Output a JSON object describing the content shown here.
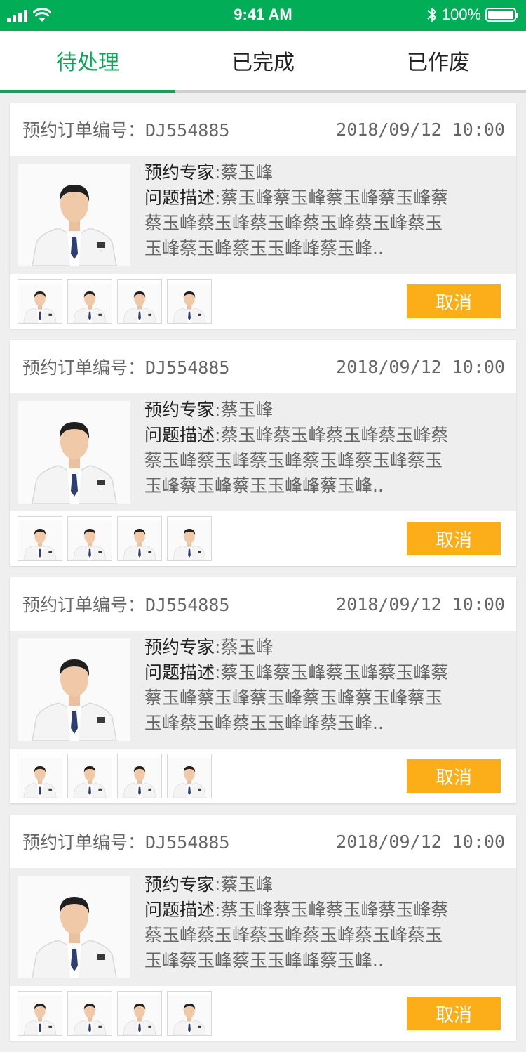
{
  "status_bar": {
    "time": "9:41 AM",
    "battery": "100%"
  },
  "tabs": [
    {
      "label": "待处理",
      "active": true
    },
    {
      "label": "已完成",
      "active": false
    },
    {
      "label": "已作废",
      "active": false
    }
  ],
  "orders": [
    {
      "order_label": "预约订单编号：DJ554885",
      "datetime": "2018/09/12 10:00",
      "expert_label": "预约专家",
      "expert_name": ":蔡玉峰",
      "desc_label": "问题描述",
      "desc_line1": ":蔡玉峰蔡玉峰蔡玉峰蔡玉峰蔡",
      "desc_line2": "蔡玉峰蔡玉峰蔡玉峰蔡玉峰蔡玉峰蔡玉",
      "desc_line3": "玉峰蔡玉峰蔡玉玉峰峰蔡玉峰..",
      "cancel_label": "取消"
    },
    {
      "order_label": "预约订单编号：DJ554885",
      "datetime": "2018/09/12 10:00",
      "expert_label": "预约专家",
      "expert_name": ":蔡玉峰",
      "desc_label": "问题描述",
      "desc_line1": ":蔡玉峰蔡玉峰蔡玉峰蔡玉峰蔡",
      "desc_line2": "蔡玉峰蔡玉峰蔡玉峰蔡玉峰蔡玉峰蔡玉",
      "desc_line3": "玉峰蔡玉峰蔡玉玉峰峰蔡玉峰..",
      "cancel_label": "取消"
    },
    {
      "order_label": "预约订单编号：DJ554885",
      "datetime": "2018/09/12 10:00",
      "expert_label": "预约专家",
      "expert_name": ":蔡玉峰",
      "desc_label": "问题描述",
      "desc_line1": ":蔡玉峰蔡玉峰蔡玉峰蔡玉峰蔡",
      "desc_line2": "蔡玉峰蔡玉峰蔡玉峰蔡玉峰蔡玉峰蔡玉",
      "desc_line3": "玉峰蔡玉峰蔡玉玉峰峰蔡玉峰..",
      "cancel_label": "取消"
    },
    {
      "order_label": "预约订单编号：DJ554885",
      "datetime": "2018/09/12 10:00",
      "expert_label": "预约专家",
      "expert_name": ":蔡玉峰",
      "desc_label": "问题描述",
      "desc_line1": ":蔡玉峰蔡玉峰蔡玉峰蔡玉峰蔡",
      "desc_line2": "蔡玉峰蔡玉峰蔡玉峰蔡玉峰蔡玉峰蔡玉",
      "desc_line3": "玉峰蔡玉峰蔡玉玉峰峰蔡玉峰..",
      "cancel_label": "取消"
    }
  ],
  "colors": {
    "brand_green": "#02ad57",
    "tab_active": "#12a35a",
    "cancel_button": "#fbae17"
  },
  "icons": [
    "signal-icon",
    "wifi-icon",
    "bluetooth-icon",
    "battery-icon",
    "doctor-photo"
  ]
}
